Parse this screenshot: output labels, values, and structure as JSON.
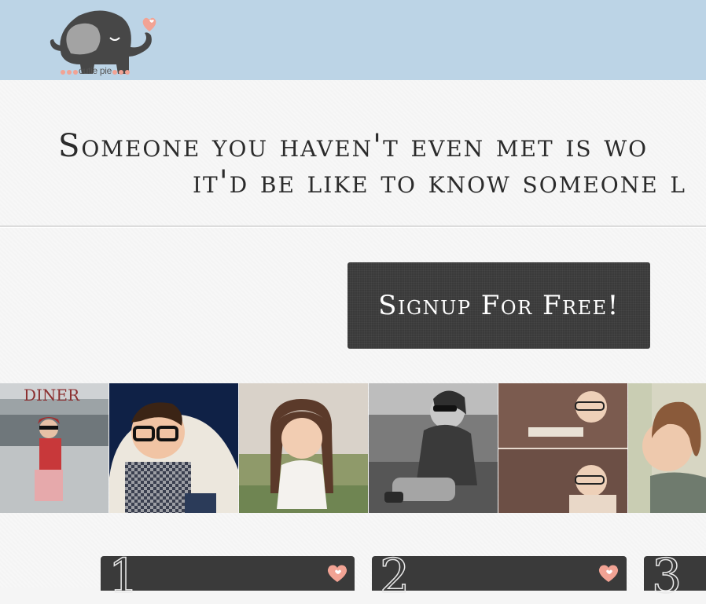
{
  "brand": {
    "logo_text": "cutie pie",
    "header_color": "#bcd4e6",
    "heart_color": "#f2a394",
    "elephant_color": "#474747"
  },
  "hero": {
    "headline_line1": "Someone you haven't even met is wo",
    "headline_line2": "it'd be like to know someone l"
  },
  "cta": {
    "signup_label": "Signup For Free!"
  },
  "photos": [
    {
      "name": "girl-at-diner-photo",
      "sign_text": "DINER"
    },
    {
      "name": "boy-in-glasses-photo"
    },
    {
      "name": "girl-with-braids-photo"
    },
    {
      "name": "child-in-sunglasses-photo"
    },
    {
      "name": "baby-reading-photo"
    },
    {
      "name": "curly-haired-child-photo"
    }
  ],
  "steps": [
    {
      "number": "1"
    },
    {
      "number": "2"
    },
    {
      "number": "3"
    }
  ]
}
